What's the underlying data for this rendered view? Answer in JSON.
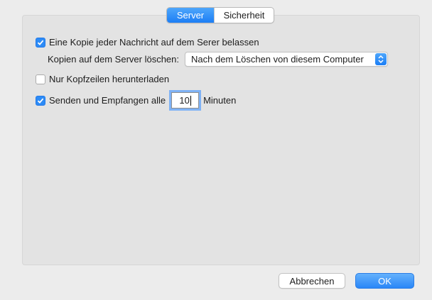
{
  "tabs": [
    {
      "label": "Server",
      "selected": true
    },
    {
      "label": "Sicherheit",
      "selected": false
    }
  ],
  "options": {
    "keep_copy": {
      "label": "Eine Kopie jeder Nachricht auf dem Serer belassen",
      "checked": true
    },
    "delete_copies": {
      "label": "Kopien auf dem Server löschen:",
      "selected": "Nach dem Löschen von diesem Computer"
    },
    "headers_only": {
      "label": "Nur Kopfzeilen herunterladen",
      "checked": false
    },
    "send_receive": {
      "label": "Senden und Empfangen alle",
      "value": "10",
      "unit": "Minuten",
      "checked": true
    }
  },
  "buttons": {
    "cancel": "Abbrechen",
    "ok": "OK"
  },
  "colors": {
    "accent": "#1c7ef5",
    "panel": "#e3e3e3",
    "window": "#ececec"
  }
}
